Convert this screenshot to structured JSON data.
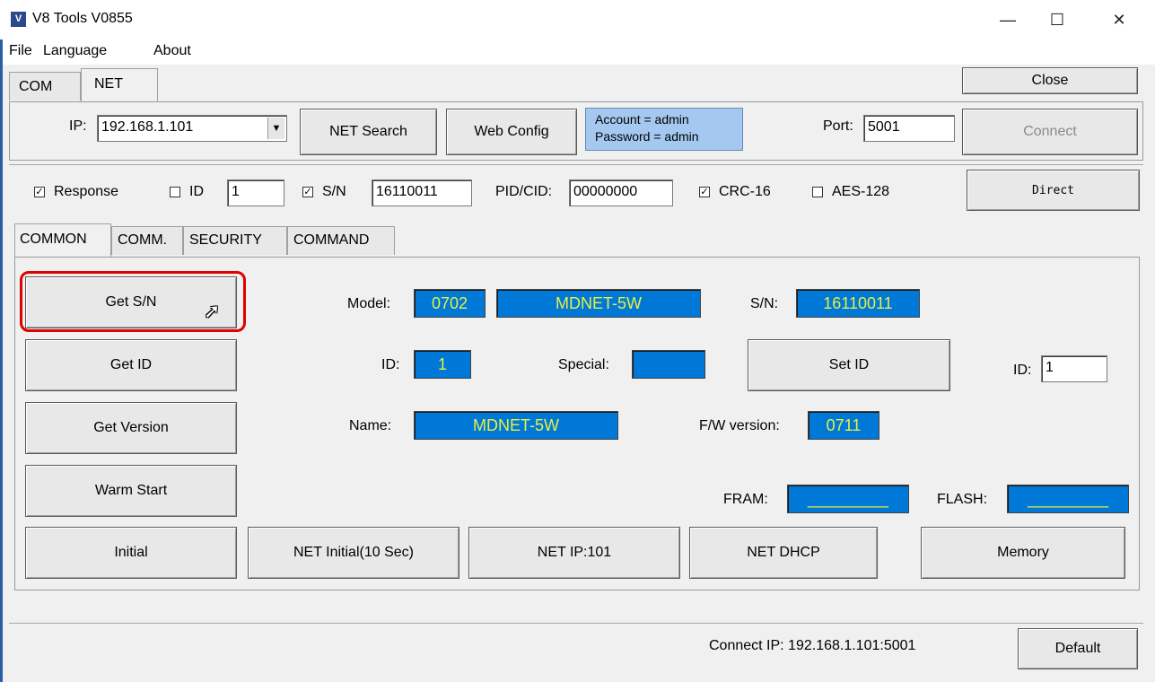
{
  "window": {
    "title": "V8 Tools V0855",
    "icon": "app-icon",
    "minimize": "—",
    "maximize": "☐",
    "close": "✕"
  },
  "menu": {
    "file": "File",
    "language": "Language",
    "about": "About"
  },
  "tabs_top": {
    "com": "COM",
    "net": "NET"
  },
  "close_button": "Close",
  "net_row": {
    "ip_label": "IP:",
    "ip_value": "192.168.1.101",
    "net_search": "NET Search",
    "web_config": "Web Config",
    "account_line": "Account = admin",
    "password_line": "Password = admin",
    "port_label": "Port:",
    "port_value": "5001",
    "connect": "Connect"
  },
  "options_row": {
    "response_label": "Response",
    "response_checked": true,
    "id_label": "ID",
    "id_checked": false,
    "id_value": "1",
    "sn_label": "S/N",
    "sn_checked": true,
    "sn_value": "16110011",
    "pidcid_label": "PID/CID:",
    "pidcid_value": "00000000",
    "crc_label": "CRC-16",
    "crc_checked": true,
    "aes_label": "AES-128",
    "aes_checked": false,
    "direct": "Direct"
  },
  "tabs_inner": {
    "common": "COMMON",
    "comm": "COMM.",
    "security": "SECURITY",
    "command": "COMMAND"
  },
  "common": {
    "get_sn": "Get S/N",
    "get_id": "Get ID",
    "get_version": "Get Version",
    "warm_start": "Warm Start",
    "initial": "Initial",
    "net_initial": "NET Initial(10 Sec)",
    "net_ip": "NET IP:101",
    "net_dhcp": "NET DHCP",
    "memory": "Memory",
    "model_label": "Model:",
    "model_code": "0702",
    "model_name": "MDNET-5W",
    "sn_label": "S/N:",
    "sn_value": "16110011",
    "id_label": "ID:",
    "id_value": "1",
    "special_label": "Special:",
    "special_value": "",
    "set_id": "Set ID",
    "set_id_label": "ID:",
    "set_id_value": "1",
    "name_label": "Name:",
    "name_value": "MDNET-5W",
    "fw_label": "F/W version:",
    "fw_value": "0711",
    "fram_label": "FRAM:",
    "fram_value": "_________",
    "flash_label": "FLASH:",
    "flash_value": "_________"
  },
  "status": {
    "connect_ip": "Connect IP: 192.168.1.101:5001",
    "default": "Default"
  },
  "colors": {
    "highlight": "#e00000",
    "blue_box": "#0078d7",
    "blue_text": "#e8f040"
  }
}
